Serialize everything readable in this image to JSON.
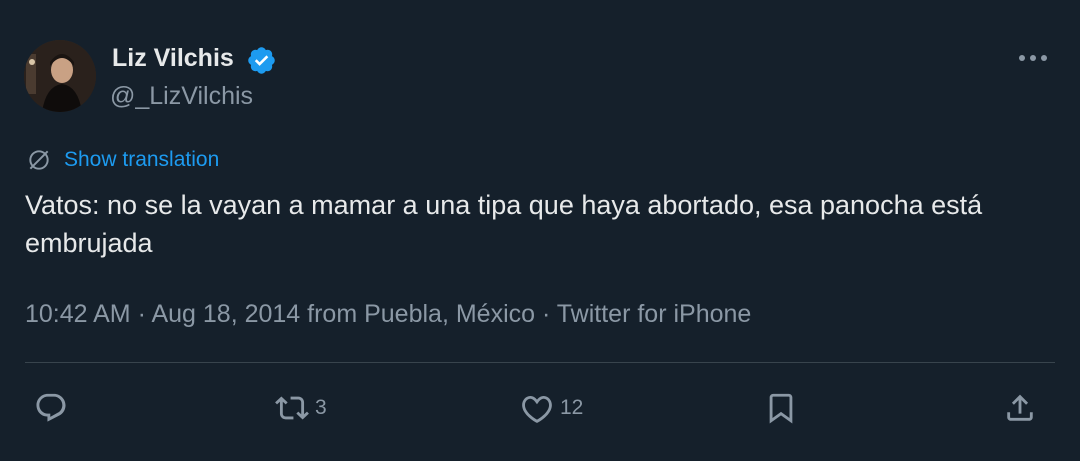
{
  "author": {
    "display_name": "Liz Vilchis",
    "handle": "@_LizVilchis",
    "verified": true
  },
  "translate_label": "Show translation",
  "text": "Vatos: no se la vayan a mamar a una tipa que haya abortado, esa panocha está embrujada",
  "meta": "10:42 AM · Aug 18, 2014 from Puebla, México · Twitter for iPhone",
  "actions": {
    "reply_count": "",
    "retweet_count": "3",
    "like_count": "12"
  },
  "colors": {
    "background": "#15202b",
    "text": "#e7e9ea",
    "secondary": "#8b98a5",
    "accent": "#1d9bf0",
    "divider": "#38444d"
  },
  "icons": [
    "avatar",
    "verified-badge-icon",
    "more-icon",
    "translate-icon",
    "reply-icon",
    "retweet-icon",
    "like-icon",
    "bookmark-icon",
    "share-icon"
  ]
}
